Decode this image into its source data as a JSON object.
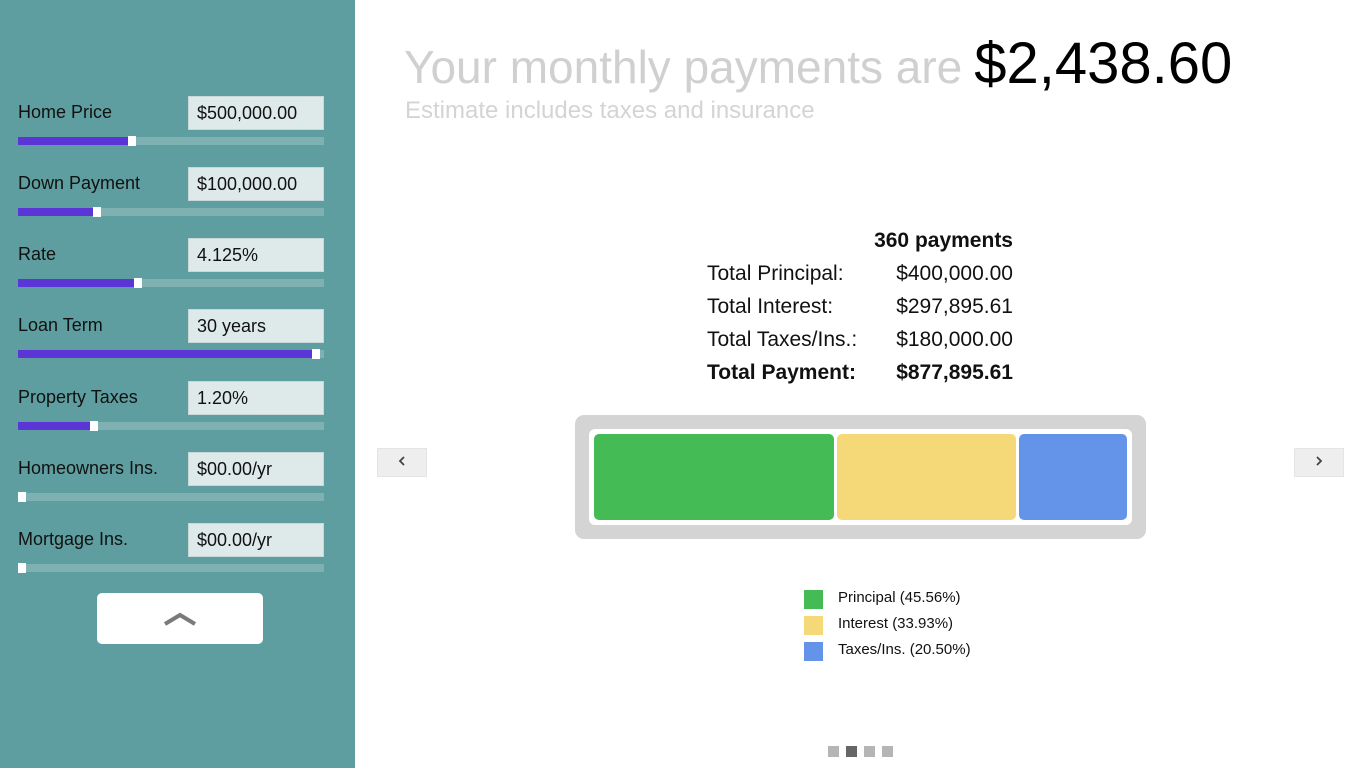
{
  "sidebar": {
    "fields": [
      {
        "label": "Home Price",
        "value": "$500,000.00",
        "slider_fraction": 0.37
      },
      {
        "label": "Down Payment",
        "value": "$100,000.00",
        "slider_fraction": 0.25
      },
      {
        "label": "Rate",
        "value": "4.125%",
        "slider_fraction": 0.39
      },
      {
        "label": "Loan Term",
        "value": "30 years",
        "slider_fraction": 0.985
      },
      {
        "label": "Property Taxes",
        "value": "1.20%",
        "slider_fraction": 0.24
      },
      {
        "label": "Homeowners Ins.",
        "value": "$00.00/yr",
        "slider_fraction": 0.0
      },
      {
        "label": "Mortgage Ins.",
        "value": "$00.00/yr",
        "slider_fraction": 0.0
      }
    ],
    "collapse_icon": "chevron-up-icon"
  },
  "main": {
    "headline_label": "Your monthly payments are",
    "headline_amount": "$2,438.60",
    "subline": "Estimate includes taxes and insurance",
    "summary": {
      "title": "360 payments",
      "rows": [
        {
          "label": "Total Principal:",
          "value": "$400,000.00"
        },
        {
          "label": "Total Interest:",
          "value": "$297,895.61"
        },
        {
          "label": "Total Taxes/Ins.:",
          "value": "$180,000.00"
        },
        {
          "label": "Total Payment:",
          "value": "$877,895.61"
        }
      ]
    },
    "breakdown": [
      {
        "name": "Principal",
        "percent": 45.56,
        "legend": "Principal (45.56%)",
        "color": "#44bb55"
      },
      {
        "name": "Interest",
        "percent": 33.93,
        "legend": "Interest (33.93%)",
        "color": "#f5d878"
      },
      {
        "name": "Taxes/Ins.",
        "percent": 20.5,
        "legend": "Taxes/Ins. (20.50%)",
        "color": "#6494ea"
      }
    ],
    "nav": {
      "prev_icon": "chevron-left-icon",
      "next_icon": "chevron-right-icon"
    },
    "pager": {
      "count": 4,
      "active": 1
    }
  },
  "colors": {
    "sidebar_bg": "#5f9ea0",
    "slider_fill": "#5b35d5",
    "slider_track": "#7fb1b2"
  }
}
